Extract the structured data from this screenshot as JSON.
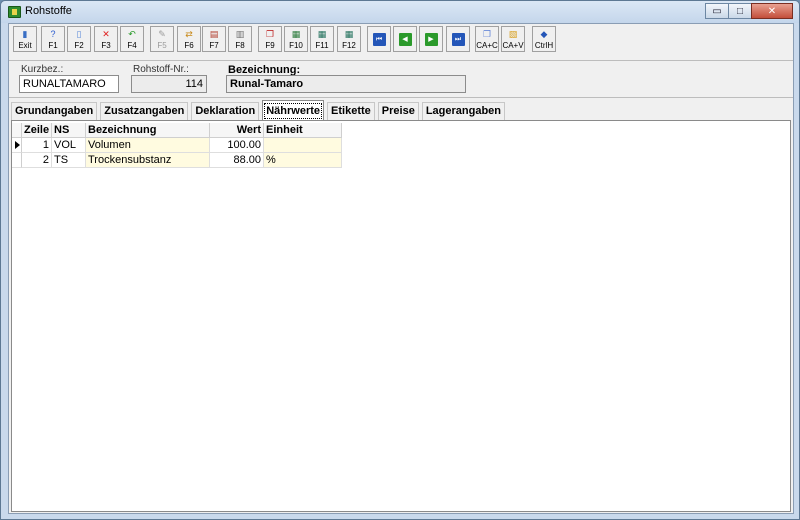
{
  "window": {
    "title": "Rohstoffe",
    "controls": {
      "minimize": "▭",
      "maximize": "□",
      "close": "✕"
    }
  },
  "toolbar": {
    "buttons": [
      {
        "id": "exit",
        "label": "Exit",
        "icon": "exit-door-icon",
        "color": "#3a6fc4",
        "enabled": true
      },
      {
        "id": "f1",
        "label": "F1",
        "icon": "help-icon",
        "color": "#2a5bd0",
        "enabled": true
      },
      {
        "id": "f2",
        "label": "F2",
        "icon": "new-document-icon",
        "color": "#5a8ad8",
        "enabled": true
      },
      {
        "id": "f3",
        "label": "F3",
        "icon": "delete-x-icon",
        "color": "#e02020",
        "enabled": true
      },
      {
        "id": "f4",
        "label": "F4",
        "icon": "undo-arrow-icon",
        "color": "#2b9a2b",
        "enabled": true
      },
      {
        "id": "f5",
        "label": "F5",
        "icon": "edit-pencil-icon",
        "color": "#9a9a9a",
        "enabled": false
      },
      {
        "id": "f6",
        "label": "F6",
        "icon": "transfer-icon",
        "color": "#c88a1a",
        "enabled": true
      },
      {
        "id": "f7",
        "label": "F7",
        "icon": "print-preview-icon",
        "color": "#b03a2a",
        "enabled": true
      },
      {
        "id": "f8",
        "label": "F8",
        "icon": "printer-icon",
        "color": "#707070",
        "enabled": true
      },
      {
        "id": "f9",
        "label": "F9",
        "icon": "copy-red-icon",
        "color": "#c02a2a",
        "enabled": true
      },
      {
        "id": "f10",
        "label": "F10",
        "icon": "calculator-icon",
        "color": "#2a7a3a",
        "enabled": true
      },
      {
        "id": "f11",
        "label": "F11",
        "icon": "table-icon",
        "color": "#1f6f5a",
        "enabled": true
      },
      {
        "id": "f12",
        "label": "F12",
        "icon": "table-calc-icon",
        "color": "#1f6f5a",
        "enabled": true
      },
      {
        "id": "first",
        "label": "",
        "icon": "first-record-icon",
        "color": "#2456b8",
        "enabled": true
      },
      {
        "id": "prev",
        "label": "",
        "icon": "previous-record-icon",
        "color": "#2b9a2b",
        "enabled": true
      },
      {
        "id": "next",
        "label": "",
        "icon": "next-record-icon",
        "color": "#2b9a2b",
        "enabled": true
      },
      {
        "id": "last",
        "label": "",
        "icon": "last-record-icon",
        "color": "#2456b8",
        "enabled": true
      },
      {
        "id": "cac",
        "label": "CA+C",
        "icon": "copy-icon",
        "color": "#6a8ad8",
        "enabled": true
      },
      {
        "id": "cav",
        "label": "CA+V",
        "icon": "paste-icon",
        "color": "#d8a020",
        "enabled": true
      },
      {
        "id": "ctrlh",
        "label": "CtrlH",
        "icon": "diamond-nav-icon",
        "color": "#2456b8",
        "enabled": true
      }
    ]
  },
  "header": {
    "kurzbez_label": "Kurzbez.:",
    "kurzbez_value": "RUNALTAMARO",
    "nr_label": "Rohstoff-Nr.:",
    "nr_value": "114",
    "bez_label": "Bezeichnung:",
    "bez_value": "Runal-Tamaro"
  },
  "tabs": [
    {
      "label": "Grundangaben",
      "active": false
    },
    {
      "label": "Zusatzangaben",
      "active": false
    },
    {
      "label": "Deklaration",
      "active": false
    },
    {
      "label": "Nährwerte",
      "active": true
    },
    {
      "label": "Etikette",
      "active": false
    },
    {
      "label": "Preise",
      "active": false
    },
    {
      "label": "Lagerangaben",
      "active": false
    }
  ],
  "grid": {
    "columns": [
      "Zeile",
      "NS",
      "Bezeichnung",
      "Wert",
      "Einheit"
    ],
    "rows": [
      {
        "zeile": "1",
        "ns": "VOL",
        "bezeichnung": "Volumen",
        "wert": "100.00",
        "einheit": "",
        "current": true
      },
      {
        "zeile": "2",
        "ns": "TS",
        "bezeichnung": "Trockensubstanz",
        "wert": "88.00",
        "einheit": "%",
        "current": false
      }
    ]
  }
}
